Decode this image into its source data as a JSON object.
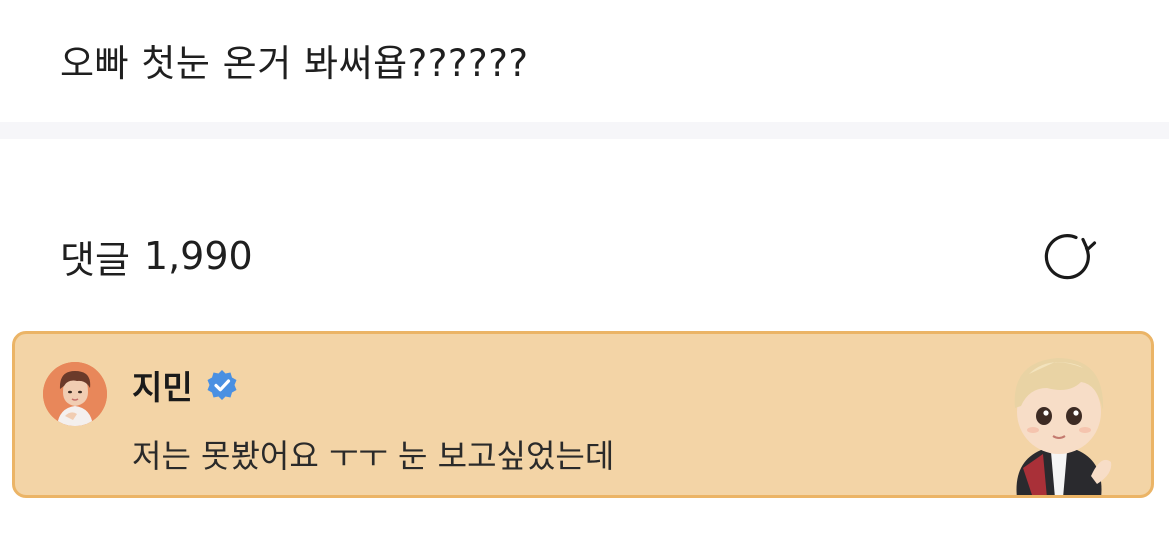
{
  "post": {
    "text": "오빠 첫눈 온거 봐써욥??????"
  },
  "comments": {
    "label": "댓글",
    "count": "1,990",
    "refresh_icon": "refresh-icon"
  },
  "pinned_comment": {
    "author": "지민",
    "verified_icon": "verified-badge-icon",
    "text": "저는 못봤어요 ㅜㅜ 눈 보고싶었는데",
    "avatar": "avatar",
    "sticker": "character-sticker"
  },
  "colors": {
    "card_background": "#f3d4a6",
    "card_border": "#ebb466",
    "verified_blue": "#4a90e2",
    "divider": "#f6f6f9"
  }
}
